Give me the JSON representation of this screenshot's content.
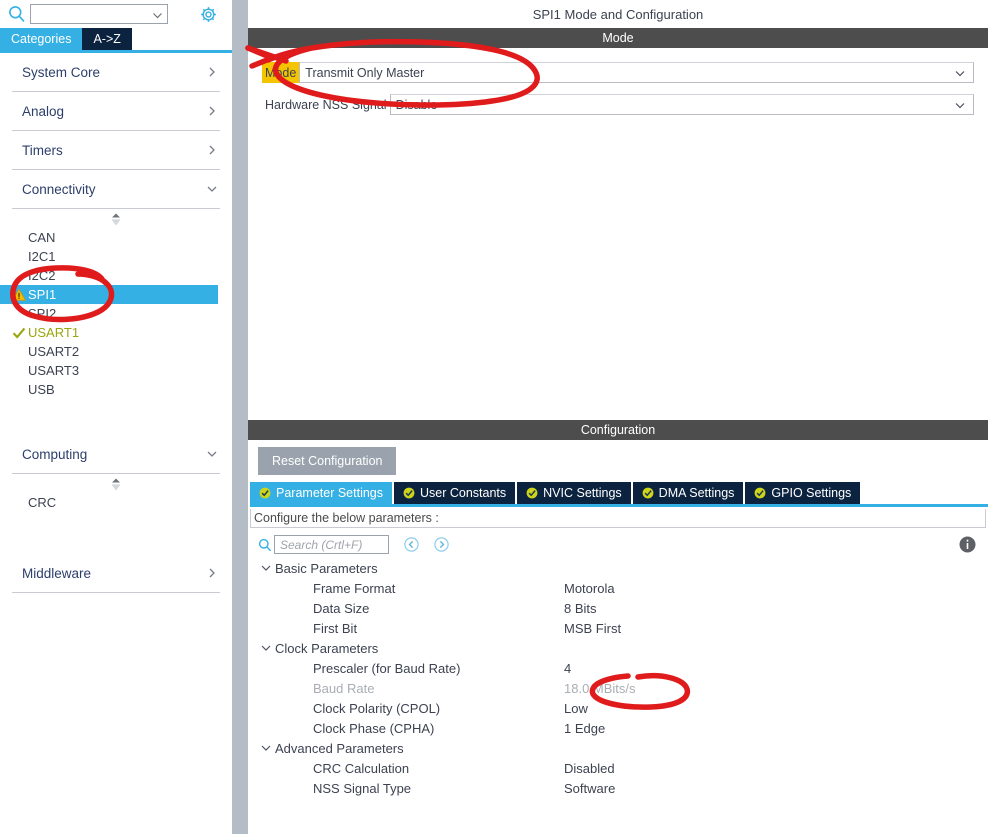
{
  "sidebar": {
    "search": {
      "value": "",
      "placeholder": "",
      "icon": "search-icon",
      "chevron": "chevron-down-icon"
    },
    "gear_icon": "gear-icon",
    "tabs": [
      {
        "label": "Categories",
        "active": true
      },
      {
        "label": "A->Z",
        "active": false
      }
    ],
    "categories": [
      {
        "label": "System Core",
        "expanded": false,
        "items": []
      },
      {
        "label": "Analog",
        "expanded": false,
        "items": []
      },
      {
        "label": "Timers",
        "expanded": false,
        "items": []
      },
      {
        "label": "Connectivity",
        "expanded": true,
        "items": [
          {
            "label": "CAN",
            "state": "none",
            "selected": false
          },
          {
            "label": "I2C1",
            "state": "none",
            "selected": false
          },
          {
            "label": "I2C2",
            "state": "none",
            "selected": false
          },
          {
            "label": "SPI1",
            "state": "warning",
            "selected": true
          },
          {
            "label": "SPI2",
            "state": "none",
            "selected": false
          },
          {
            "label": "USART1",
            "state": "ok",
            "selected": false
          },
          {
            "label": "USART2",
            "state": "none",
            "selected": false
          },
          {
            "label": "USART3",
            "state": "none",
            "selected": false
          },
          {
            "label": "USB",
            "state": "none",
            "selected": false
          }
        ]
      },
      {
        "label": "Computing",
        "expanded": true,
        "items": [
          {
            "label": "CRC",
            "state": "none",
            "selected": false
          }
        ]
      },
      {
        "label": "Middleware",
        "expanded": false,
        "items": []
      }
    ]
  },
  "main": {
    "title": "SPI1 Mode and Configuration",
    "mode_section": {
      "header": "Mode",
      "fields": [
        {
          "label": "Mode",
          "value": "Transmit Only Master",
          "highlighted": true
        },
        {
          "label": "Hardware NSS Signal",
          "value": "Disable",
          "highlighted": false
        }
      ]
    },
    "configuration_section": {
      "header": "Configuration",
      "reset_label": "Reset Configuration",
      "tabs": [
        {
          "label": "Parameter Settings",
          "active": true
        },
        {
          "label": "User Constants",
          "active": false
        },
        {
          "label": "NVIC Settings",
          "active": false
        },
        {
          "label": "DMA Settings",
          "active": false
        },
        {
          "label": "GPIO Settings",
          "active": false
        }
      ],
      "note": "Configure the below parameters :",
      "toolbar": {
        "search_value": "",
        "search_placeholder": "Search (Crtl+F)",
        "search_icon": "search-icon",
        "back_icon": "circle-arrow-left-icon",
        "forward_icon": "circle-arrow-right-icon",
        "info_icon": "info-icon"
      },
      "parameter_groups": [
        {
          "label": "Basic Parameters",
          "expanded": true,
          "rows": [
            {
              "name": "Frame Format",
              "value": "Motorola",
              "disabled": false
            },
            {
              "name": "Data Size",
              "value": "8 Bits",
              "disabled": false
            },
            {
              "name": "First Bit",
              "value": "MSB First",
              "disabled": false
            }
          ]
        },
        {
          "label": "Clock Parameters",
          "expanded": true,
          "rows": [
            {
              "name": "Prescaler (for Baud Rate)",
              "value": "4",
              "disabled": false
            },
            {
              "name": "Baud Rate",
              "value": "18.0 MBits/s",
              "disabled": true
            },
            {
              "name": "Clock Polarity (CPOL)",
              "value": "Low",
              "disabled": false
            },
            {
              "name": "Clock Phase (CPHA)",
              "value": "1 Edge",
              "disabled": false
            }
          ]
        },
        {
          "label": "Advanced Parameters",
          "expanded": true,
          "rows": [
            {
              "name": "CRC Calculation",
              "value": "Disabled",
              "disabled": false
            },
            {
              "name": "NSS Signal Type",
              "value": "Software",
              "disabled": false
            }
          ]
        }
      ]
    }
  },
  "annotations": {
    "color": "#e01b1b",
    "marks": [
      {
        "name": "spi1-circle",
        "shape": "ellipse"
      },
      {
        "name": "mode-dropdown-circle",
        "shape": "ellipse-with-arrow"
      },
      {
        "name": "prescaler-circle",
        "shape": "ellipse"
      }
    ]
  },
  "colors": {
    "accent_cyan": "#35b0e4",
    "tab_navy": "#0c2340",
    "section_bar_grey": "#4d4d4d",
    "highlight_yellow": "#f5c400",
    "warning_yellow": "#f5bd00",
    "ok_green": "#9aa60d",
    "annotation_red": "#e01b1b",
    "splitter_grey": "#b4bcc6"
  }
}
